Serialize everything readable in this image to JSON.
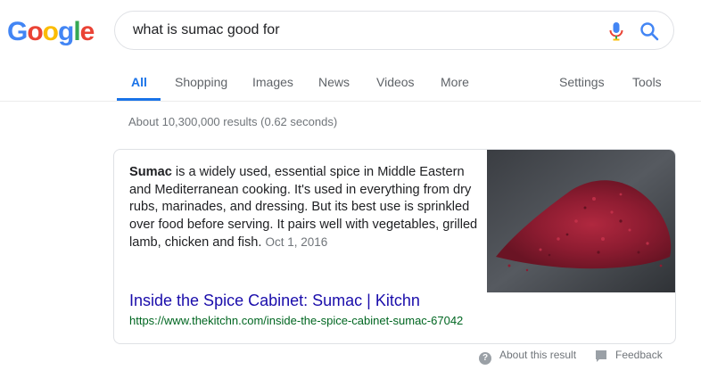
{
  "logo": {
    "letters": [
      "G",
      "o",
      "o",
      "g",
      "l",
      "e"
    ],
    "colors": [
      "#4285f4",
      "#ea4335",
      "#fbbc05",
      "#4285f4",
      "#34a853",
      "#ea4335"
    ]
  },
  "search": {
    "query": "what is sumac good for",
    "mic_icon": "mic-icon",
    "search_icon": "search-icon"
  },
  "tabs": [
    {
      "label": "All",
      "active": true
    },
    {
      "label": "Shopping"
    },
    {
      "label": "Images"
    },
    {
      "label": "News"
    },
    {
      "label": "Videos"
    },
    {
      "label": "More"
    },
    {
      "label": "Settings"
    },
    {
      "label": "Tools"
    }
  ],
  "result_stats": "About 10,300,000 results (0.62 seconds)",
  "featured_snippet": {
    "bold_term": "Sumac",
    "text": " is a widely used, essential spice in Middle Eastern and Mediterranean cooking. It's used in everything from dry rubs, marinades, and dressing. But its best use is sprinkled over food before serving. It pairs well with vegetables, grilled lamb, chicken and fish.",
    "date": "Oct 1, 2016",
    "title": "Inside the Spice Cabinet: Sumac | Kitchn",
    "url": "https://www.thekitchn.com/inside-the-spice-cabinet-sumac-67042"
  },
  "footer": {
    "about": "About this result",
    "feedback": "Feedback"
  }
}
